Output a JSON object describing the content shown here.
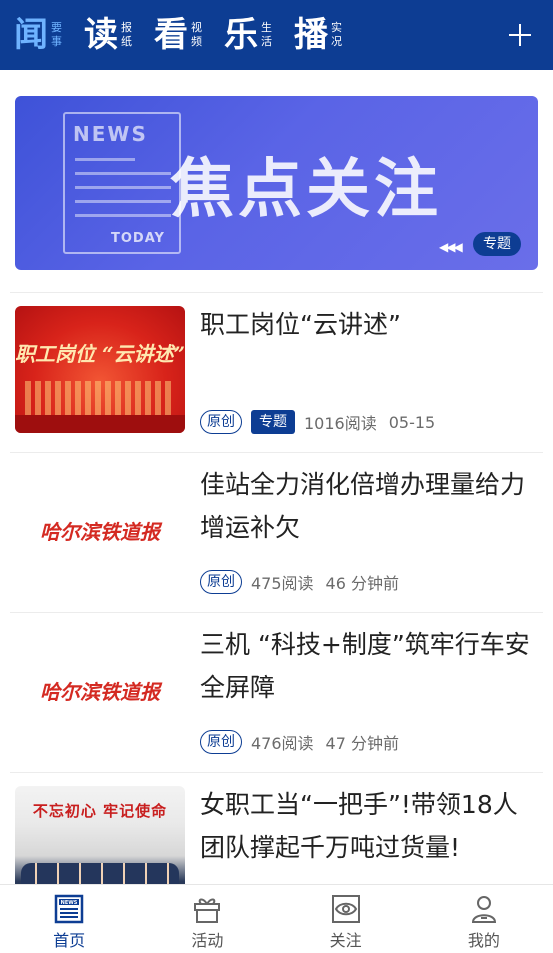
{
  "top_nav": {
    "tabs": [
      {
        "main": "闻",
        "sub1": "要",
        "sub2": "事"
      },
      {
        "main": "读",
        "sub1": "报",
        "sub2": "纸"
      },
      {
        "main": "看",
        "sub1": "视",
        "sub2": "频"
      },
      {
        "main": "乐",
        "sub1": "生",
        "sub2": "活"
      },
      {
        "main": "播",
        "sub1": "实",
        "sub2": "况"
      }
    ],
    "plus_icon": "plus-icon"
  },
  "banner": {
    "doc_news": "NEWS",
    "doc_today": "TODAY",
    "headline": "焦点关注",
    "badge": "专题"
  },
  "news": [
    {
      "title": "职工岗位“云讲述”",
      "thumb_text": "职工岗位 “云讲述”",
      "tag_original": "原创",
      "tag_topic": "专题",
      "reads": "1016阅读",
      "time": "05-15"
    },
    {
      "title": "佳站全力消化倍增办理量给力增运补欠",
      "thumb_text": "哈尔滨铁道报",
      "tag_original": "原创",
      "reads": "475阅读",
      "time": "46 分钟前"
    },
    {
      "title": "三机 “科技+制度”筑牢行车安全屏障",
      "thumb_text": "哈尔滨铁道报",
      "tag_original": "原创",
      "reads": "476阅读",
      "time": "47 分钟前"
    },
    {
      "title": "女职工当“一把手”!带领18人团队撑起千万吨过货量!",
      "thumb_text": "不忘初心 牢记使命"
    }
  ],
  "bottom_nav": {
    "items": [
      {
        "label": "首页",
        "icon": "news-icon"
      },
      {
        "label": "活动",
        "icon": "gift-icon"
      },
      {
        "label": "关注",
        "icon": "eye-icon"
      },
      {
        "label": "我的",
        "icon": "user-icon"
      }
    ]
  },
  "colors": {
    "brand": "#0d3d93",
    "active_tab": "#6fb3ff",
    "banner": "#4b5be0"
  }
}
